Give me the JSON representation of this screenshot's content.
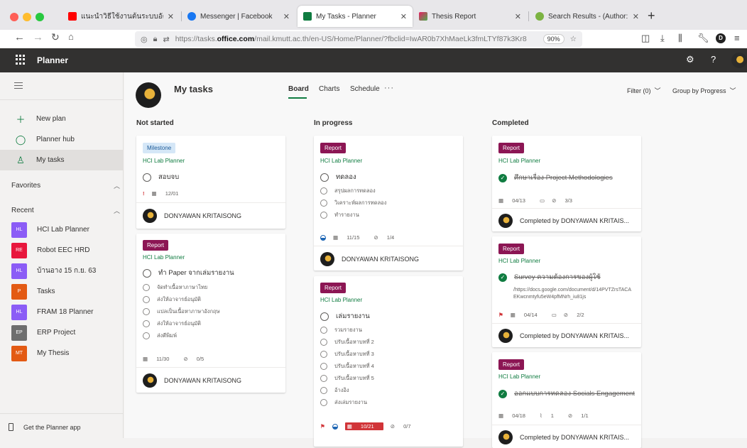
{
  "browser": {
    "tabs": [
      {
        "title": "แนะนำวิธีใช้งานต้นระบบอัตโนมัติใ"
      },
      {
        "title": "Messenger | Facebook"
      },
      {
        "title": "My Tasks - Planner"
      },
      {
        "title": "Thesis Report"
      },
      {
        "title": "Search Results - (Author:..."
      }
    ],
    "url_prefix": "https://tasks.",
    "url_domain": "office.com",
    "url_suffix": "/mail.kmutt.ac.th/en-US/Home/Planner/?fbclid=IwAR0b7XhMaeLk3fmLTYf87k3Kr8",
    "zoom": "90%",
    "profile_initial": "D"
  },
  "app": {
    "name": "Planner"
  },
  "nav": {
    "new_plan": "New plan",
    "planner_hub": "Planner hub",
    "my_tasks": "My tasks",
    "favorites": "Favorites",
    "recent": "Recent",
    "recent_plans": [
      {
        "initials": "HL",
        "name": "HCI Lab Planner",
        "color": "#8b5cf6"
      },
      {
        "initials": "RE",
        "name": "Robot EEC HRD",
        "color": "#e8173c"
      },
      {
        "initials": "HL",
        "name": "บ้านอาง 15 ก.ย. 63",
        "color": "#8b5cf6"
      },
      {
        "initials": "P",
        "name": "Tasks",
        "color": "#e35a13"
      },
      {
        "initials": "HL",
        "name": "FRAM 18 Planner",
        "color": "#8b5cf6"
      },
      {
        "initials": "EP",
        "name": "ERP Project",
        "color": "#6e6e6e"
      },
      {
        "initials": "MT",
        "name": "My Thesis",
        "color": "#e35a13"
      }
    ],
    "get_app": "Get the Planner app"
  },
  "main": {
    "title": "My tasks",
    "tabs": [
      "Board",
      "Charts",
      "Schedule"
    ],
    "more": "···",
    "filter": "Filter (0)",
    "group_by": "Group by Progress"
  },
  "columns": [
    {
      "name": "Not started",
      "cards": [
        {
          "label": "Milestone",
          "plan": "HCI Lab Planner",
          "title": "สอบจบ",
          "priority": "!",
          "due": "12/01",
          "assignee": "DONYAWAN KRITAISONG"
        },
        {
          "label": "Report",
          "plan": "HCI Lab Planner",
          "title": "ทำ Paper จากเล่มรายงาน",
          "checklist": [
            "จัดทำเนื้อหาภาษาไทย",
            "ส่งให้อาจารย์อนุมัติ",
            "แปลเป็นเนื้อหาภาษาอังกฤษ",
            "ส่งให้อาจารย์อนุมัติ",
            "ส่งตีพิมพ์"
          ],
          "due": "11/30",
          "checklist_count": "0/5",
          "assignee": "DONYAWAN KRITAISONG"
        }
      ]
    },
    {
      "name": "In progress",
      "cards": [
        {
          "label": "Report",
          "plan": "HCI Lab Planner",
          "title": "ทดลอง",
          "checklist": [
            "สรุปผลการทดลอง",
            "วิเคราะห์ผลการทดลอง",
            "ทำรายงาน"
          ],
          "due": "11/15",
          "checklist_count": "1/4",
          "assignee": "DONYAWAN KRITAISONG"
        },
        {
          "label": "Report",
          "plan": "HCI Lab Planner",
          "title": "เล่มรายงาน",
          "checklist": [
            "รวมรายงาน",
            "ปรับเนื้อหาบทที่ 2",
            "ปรับเนื้อหาบทที่ 3",
            "ปรับเนื้อหาบทที่ 4",
            "ปรับเนื้อหาบทที่ 5",
            "อ้างอิง",
            "ส่งเล่มรายงาน"
          ],
          "due": "10/21",
          "checklist_count": "0/7"
        }
      ]
    },
    {
      "name": "Completed",
      "cards": [
        {
          "label": "Report",
          "plan": "HCI Lab Planner",
          "title": "ศึกษาเรื่อง Project Methodologies",
          "due": "04/13",
          "checklist_count": "3/3",
          "assignee": "Completed by DONYAWAN KRITAIS..."
        },
        {
          "label": "Report",
          "plan": "HCI Lab Planner",
          "title": "Survey ความต้องการของผู้ใช้",
          "link": "/https://docs.google.com/document/d/14PVTZrsTACAEKwcnmtyfu5eW4pfMNrh_iu81js",
          "due": "04/14",
          "checklist_count": "2/2",
          "assignee": "Completed by DONYAWAN KRITAIS..."
        },
        {
          "label": "Report",
          "plan": "HCI Lab Planner",
          "title": "ออกแบบการทดลอง Socials Engagement",
          "due": "04/18",
          "attachments": "1",
          "checklist_count": "1/1",
          "assignee": "Completed by DONYAWAN KRITAIS..."
        }
      ]
    }
  ]
}
